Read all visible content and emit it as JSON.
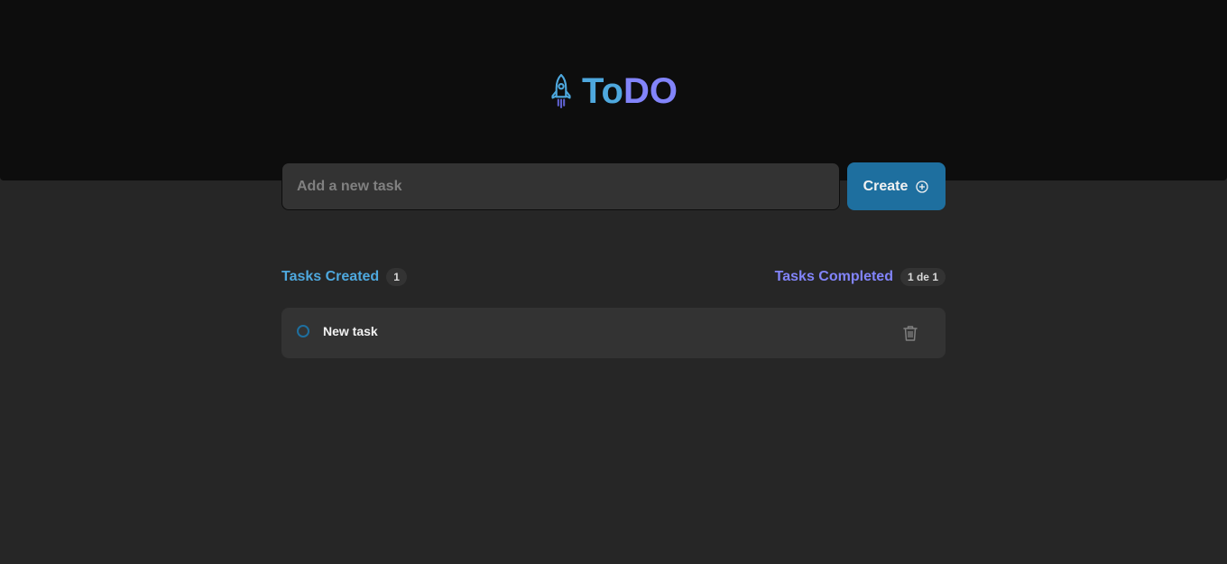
{
  "header": {
    "logo_icon": "rocket-icon",
    "title_part1": "To",
    "title_part2": "DO"
  },
  "new_task": {
    "placeholder": "Add a new task",
    "value": "",
    "create_label": "Create",
    "create_icon": "plus-circle-icon"
  },
  "counters": {
    "created_label": "Tasks Created",
    "created_count": "1",
    "completed_label": "Tasks Completed",
    "completed_count": "1 de 1"
  },
  "tasks": [
    {
      "text": "New task",
      "completed": false,
      "delete_icon": "trash-icon"
    }
  ],
  "colors": {
    "background": "#262626",
    "header": "#0d0d0d",
    "blue": "#4ea8de",
    "blue_dark": "#1e6f9f",
    "purple": "#8284fa",
    "surface": "#333333",
    "text": "#f2f2f2"
  }
}
